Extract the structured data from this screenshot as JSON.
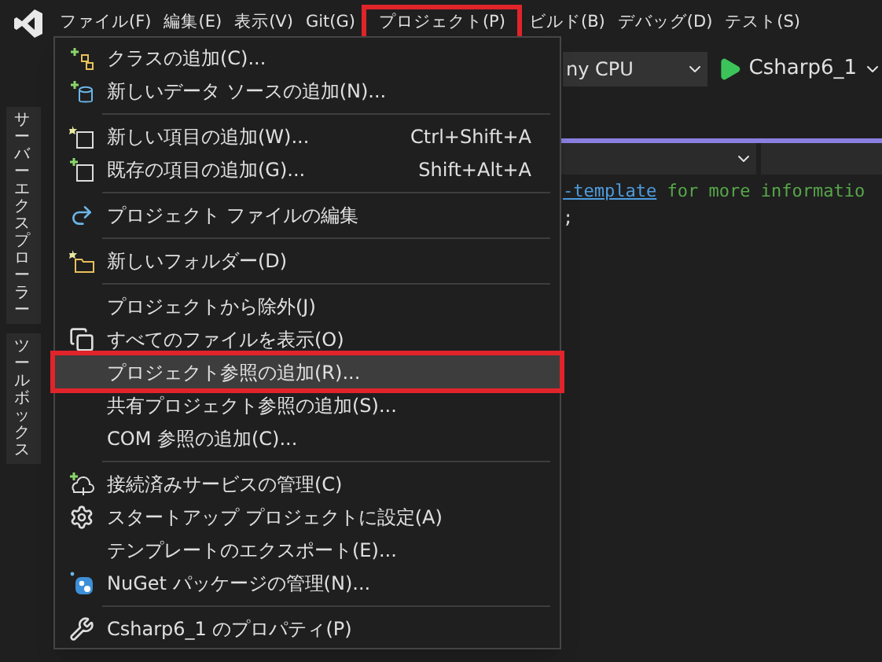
{
  "menu_bar": [
    {
      "label": "ファイル(F)",
      "selected": false
    },
    {
      "label": "編集(E)",
      "selected": false
    },
    {
      "label": "表示(V)",
      "selected": false
    },
    {
      "label": "Git(G)",
      "selected": false
    },
    {
      "label": "プロジェクト(P)",
      "selected": true
    },
    {
      "label": "ビルド(B)",
      "selected": false
    },
    {
      "label": "デバッグ(D)",
      "selected": false
    },
    {
      "label": "テスト(S)",
      "selected": false
    }
  ],
  "toolbar": {
    "platform": "ny CPU",
    "start_target": "Csharp6_1"
  },
  "side_tabs": [
    "サーバーエクスプローラー",
    "ツールボックス"
  ],
  "code_lines": [
    {
      "link": "-template",
      "comment": " for more informatio"
    },
    {
      "text": ";"
    }
  ],
  "menu_items": [
    {
      "kind": "item",
      "label": "クラスの追加(C)...",
      "selected": false
    },
    {
      "kind": "item",
      "label": "新しいデータ ソースの追加(N)...",
      "selected": false
    },
    {
      "kind": "separator"
    },
    {
      "kind": "item",
      "label": "新しい項目の追加(W)...",
      "shortcut": "Ctrl+Shift+A",
      "selected": false
    },
    {
      "kind": "item",
      "label": "既存の項目の追加(G)...",
      "shortcut": "Shift+Alt+A",
      "selected": false
    },
    {
      "kind": "separator"
    },
    {
      "kind": "item",
      "label": "プロジェクト ファイルの編集",
      "selected": false
    },
    {
      "kind": "separator"
    },
    {
      "kind": "item",
      "label": "新しいフォルダー(D)",
      "selected": false
    },
    {
      "kind": "separator"
    },
    {
      "kind": "item",
      "label": "プロジェクトから除外(J)",
      "selected": false
    },
    {
      "kind": "item",
      "label": "すべてのファイルを表示(O)",
      "selected": false
    },
    {
      "kind": "item",
      "label": "プロジェクト参照の追加(R)...",
      "selected": true
    },
    {
      "kind": "item",
      "label": "共有プロジェクト参照の追加(S)...",
      "selected": false
    },
    {
      "kind": "item",
      "label": "COM 参照の追加(C)...",
      "selected": false
    },
    {
      "kind": "separator"
    },
    {
      "kind": "item",
      "label": "接続済みサービスの管理(C)",
      "selected": false
    },
    {
      "kind": "item",
      "label": "スタートアップ プロジェクトに設定(A)",
      "selected": false
    },
    {
      "kind": "item",
      "label": "テンプレートのエクスポート(E)...",
      "selected": false
    },
    {
      "kind": "item",
      "label": "NuGet パッケージの管理(N)...",
      "selected": false
    },
    {
      "kind": "separator"
    },
    {
      "kind": "item",
      "label": "Csharp6_1 のプロパティ(P)",
      "selected": false
    }
  ]
}
